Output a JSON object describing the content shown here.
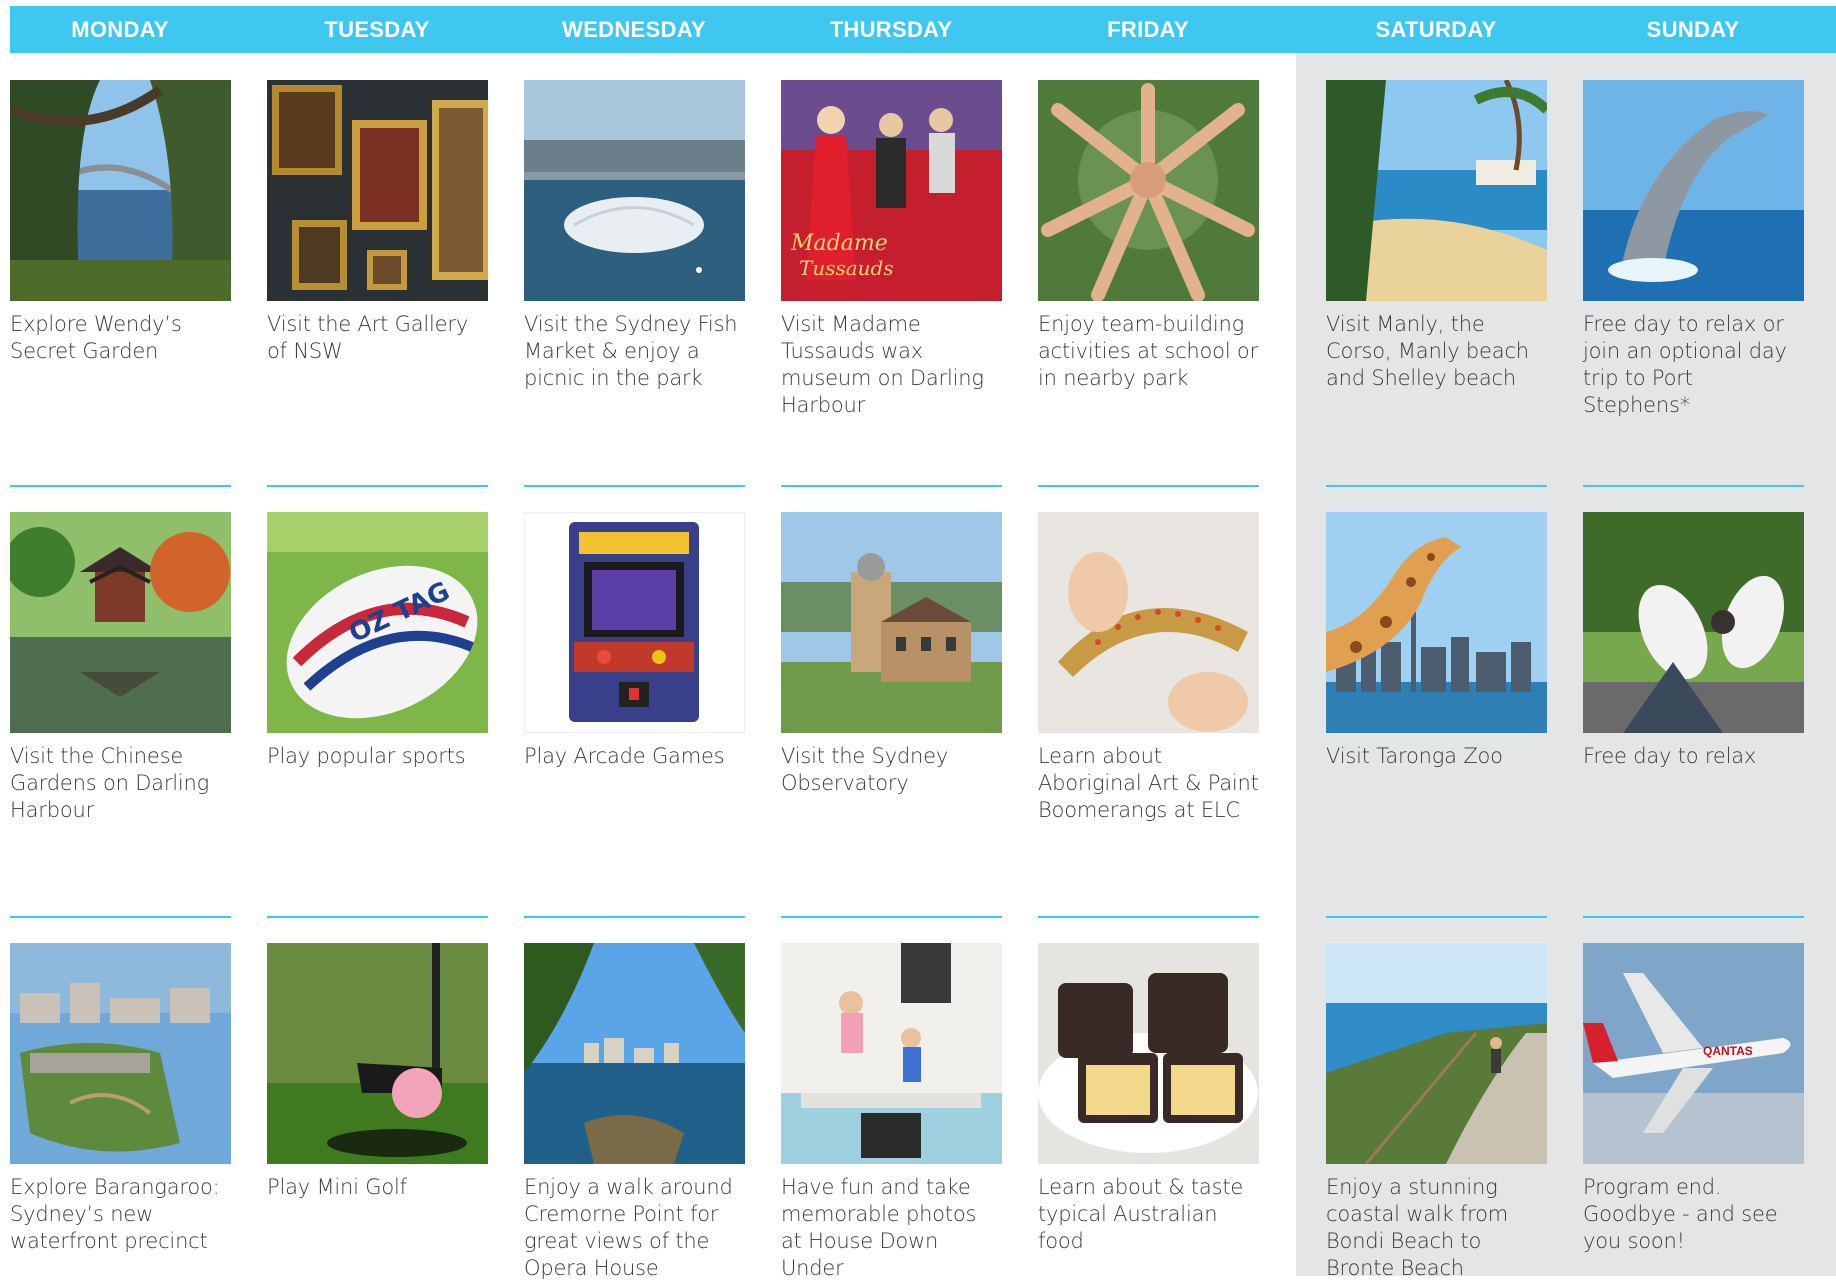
{
  "days": [
    "MONDAY",
    "TUESDAY",
    "WEDNESDAY",
    "THURSDAY",
    "FRIDAY",
    "SATURDAY",
    "SUNDAY"
  ],
  "colors": {
    "header": "#3ec8f0",
    "weekend_background": "#e3e5e7",
    "divider": "#3ec8f0",
    "text": "#3a3a3a"
  },
  "rows": [
    [
      {
        "caption": "Explore Wendy’s Secret Garden",
        "image": "harbour-bridge-garden-photo"
      },
      {
        "caption": "Visit the Art Gallery of NSW",
        "image": "art-gallery-paintings-photo"
      },
      {
        "caption": "Visit the Sydney Fish Market & enjoy a picnic in the park",
        "image": "fish-market-aerial-photo"
      },
      {
        "caption": "Visit Madame Tussauds wax museum on Darling Harbour",
        "image": "madame-tussauds-poster"
      },
      {
        "caption": "Enjoy team-building activities at school or in nearby park",
        "image": "team-hands-photo"
      },
      {
        "caption": "Visit Manly, the Corso, Manly beach and Shelley beach",
        "image": "manly-beach-photo"
      },
      {
        "caption": "Free day to relax or join an optional day trip to Port Stephens*",
        "image": "dolphin-photo"
      }
    ],
    [
      {
        "caption": "Visit the Chinese Gardens on Darling Harbour",
        "image": "chinese-garden-pagoda-photo"
      },
      {
        "caption": "Play popular sports",
        "image": "rugby-ball-photo"
      },
      {
        "caption": "Play Arcade Games",
        "image": "arcade-machine-photo"
      },
      {
        "caption": "Visit the Sydney Observatory",
        "image": "observatory-photo"
      },
      {
        "caption": "Learn about Aboriginal Art & Paint Boomerangs at ELC",
        "image": "boomerang-painting-photo"
      },
      {
        "caption": "Visit Taronga Zoo",
        "image": "giraffe-skyline-photo"
      },
      {
        "caption": "Free day to relax",
        "image": "relaxing-feet-photo"
      }
    ],
    [
      {
        "caption": "Explore Barangaroo: Sydney’s new waterfront precinct",
        "image": "barangaroo-aerial-photo"
      },
      {
        "caption": "Play Mini Golf",
        "image": "mini-golf-photo"
      },
      {
        "caption": "Enjoy a walk around Cremorne Point for great views of the Opera House",
        "image": "cremorne-point-photo"
      },
      {
        "caption": "Have fun and take memorable photos at House Down Under",
        "image": "upside-down-house-photo"
      },
      {
        "caption": "Learn about & taste typical Australian food",
        "image": "lamingtons-photo"
      },
      {
        "caption": "Enjoy a stunning coastal walk from Bondi Beach to Bronte Beach",
        "image": "coastal-walk-photo"
      },
      {
        "caption": "Program end. Goodbye - and see you soon!",
        "image": "qantas-plane-photo"
      }
    ]
  ]
}
